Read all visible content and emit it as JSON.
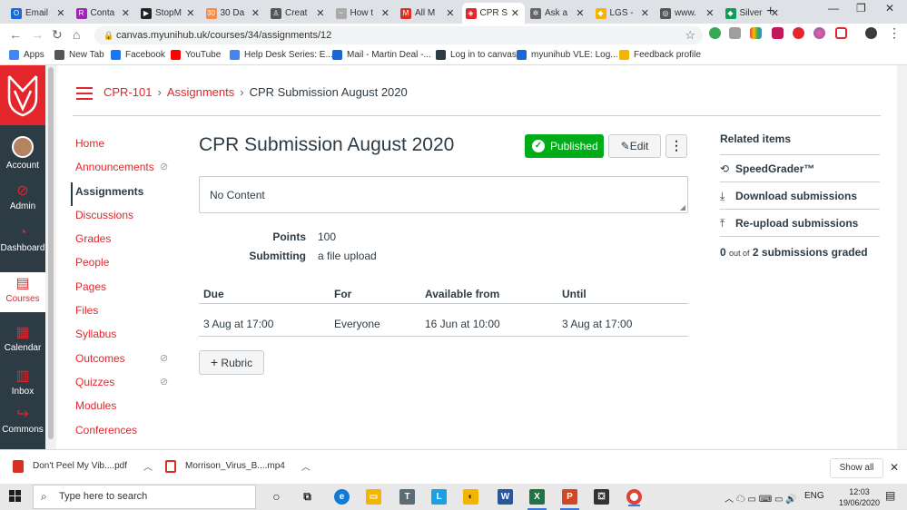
{
  "browser": {
    "tabs": [
      {
        "title": "Email",
        "color": "#1769d6",
        "glyph": "O"
      },
      {
        "title": "Conta",
        "color": "#9c27b0",
        "glyph": "R"
      },
      {
        "title": "StopM",
        "color": "#222222",
        "glyph": "▶"
      },
      {
        "title": "30 Da",
        "color": "#f48b4a",
        "glyph": "30"
      },
      {
        "title": "Creat",
        "color": "#555555",
        "glyph": "♙"
      },
      {
        "title": "How t",
        "color": "#aaaaaa",
        "glyph": "~"
      },
      {
        "title": "All M",
        "color": "#d93025",
        "glyph": "M"
      },
      {
        "title": "CPR S",
        "color": "#e2262b",
        "glyph": "◈"
      },
      {
        "title": "Ask a",
        "color": "#666666",
        "glyph": "✲"
      },
      {
        "title": "LGS -",
        "color": "#f4b400",
        "glyph": "◆"
      },
      {
        "title": "www.",
        "color": "#555555",
        "glyph": "◎"
      },
      {
        "title": "Silver",
        "color": "#0f9d58",
        "glyph": "◆"
      }
    ],
    "active_tab_index": 7,
    "url": "canvas.myunihub.uk/courses/34/assignments/12",
    "bookmarks": [
      {
        "label": "Apps",
        "color": "#4285f4"
      },
      {
        "label": "New Tab",
        "color": "#555555"
      },
      {
        "label": "Facebook",
        "color": "#1877f2"
      },
      {
        "label": "YouTube",
        "color": "#ff0000"
      },
      {
        "label": "Help Desk Series: E...",
        "color": "#4285f4"
      },
      {
        "label": "Mail - Martin Deal -...",
        "color": "#1769d6"
      },
      {
        "label": "Log in to canvas",
        "color": "#2d3b45"
      },
      {
        "label": "myunihub VLE: Log...",
        "color": "#1769d6"
      },
      {
        "label": "Feedback profile",
        "color": "#f4b400"
      }
    ]
  },
  "global_nav": {
    "items": [
      {
        "label": "Account",
        "icon": "avatar"
      },
      {
        "label": "Admin",
        "icon": "⊘"
      },
      {
        "label": "Dashboard",
        "icon": "◔"
      },
      {
        "label": "Courses",
        "icon": "▤"
      },
      {
        "label": "Calendar",
        "icon": "▦"
      },
      {
        "label": "Inbox",
        "icon": "▥"
      },
      {
        "label": "Commons",
        "icon": "↪"
      }
    ],
    "active": "Courses"
  },
  "breadcrumb": {
    "course": "CPR-101",
    "section": "Assignments",
    "current": "CPR Submission August 2020"
  },
  "course_nav": {
    "items": [
      {
        "label": "Home",
        "hidden": false
      },
      {
        "label": "Announcements",
        "hidden": true
      },
      {
        "label": "Assignments",
        "hidden": false
      },
      {
        "label": "Discussions",
        "hidden": false
      },
      {
        "label": "Grades",
        "hidden": false
      },
      {
        "label": "People",
        "hidden": false
      },
      {
        "label": "Pages",
        "hidden": false
      },
      {
        "label": "Files",
        "hidden": false
      },
      {
        "label": "Syllabus",
        "hidden": false
      },
      {
        "label": "Outcomes",
        "hidden": true
      },
      {
        "label": "Quizzes",
        "hidden": true
      },
      {
        "label": "Modules",
        "hidden": false
      },
      {
        "label": "Conferences",
        "hidden": false
      }
    ],
    "active": "Assignments"
  },
  "assignment": {
    "title": "CPR Submission August 2020",
    "published_label": "Published",
    "edit_label": "Edit",
    "more_label": "⋮",
    "description": "No Content",
    "details": [
      {
        "label": "Points",
        "value": "100"
      },
      {
        "label": "Submitting",
        "value": "a file upload"
      }
    ],
    "dates_table": {
      "headers": [
        "Due",
        "For",
        "Available from",
        "Until"
      ],
      "rows": [
        [
          "3 Aug at 17:00",
          "Everyone",
          "16 Jun at 10:00",
          "3 Aug at 17:00"
        ]
      ]
    },
    "rubric_label": "Rubric"
  },
  "related": {
    "heading": "Related items",
    "items": [
      {
        "label": "SpeedGrader™",
        "icon": "speedgrader-icon"
      },
      {
        "label": "Download submissions",
        "icon": "download-icon"
      },
      {
        "label": "Re-upload submissions",
        "icon": "upload-icon"
      }
    ],
    "graded_count": "0",
    "graded_mid": "out of",
    "graded_total": "2 submissions graded"
  },
  "downloads": {
    "items": [
      {
        "label": "Don't Peel My Vib....pdf",
        "color": "#d93025"
      },
      {
        "label": "Morrison_Virus_B....mp4",
        "color": "#d93025"
      }
    ],
    "show_all": "Show all"
  },
  "taskbar": {
    "search_placeholder": "Type here to search",
    "language": "ENG",
    "time": "12:03",
    "date": "19/06/2020"
  },
  "colors": {
    "brand": "#e2262b",
    "nav_bg": "#2d3b45",
    "published": "#00ac18"
  }
}
